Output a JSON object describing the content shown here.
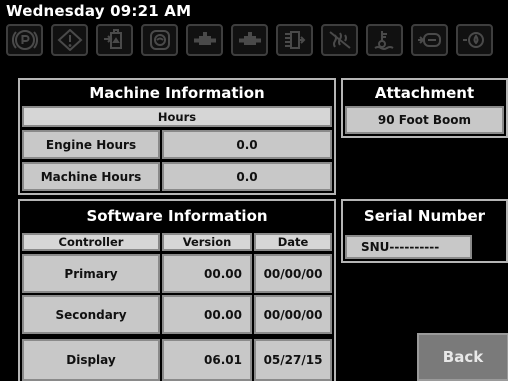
{
  "header": {
    "datetime": "Wednesday 09:21 AM",
    "icons": [
      "parking-brake-icon",
      "warning-icon",
      "fuel-filter-icon",
      "air-filter-icon",
      "hydraulic-icon",
      "hydraulic-oil-icon",
      "transmission-icon",
      "glow-plug-icon",
      "coolant-temp-icon",
      "engine-icon",
      "oil-pressure-icon"
    ]
  },
  "machine_info": {
    "title": "Machine Information",
    "hours_header": "Hours",
    "rows": [
      {
        "label": "Engine Hours",
        "value": "0.0"
      },
      {
        "label": "Machine Hours",
        "value": "0.0"
      }
    ]
  },
  "attachment": {
    "title": "Attachment",
    "value": "90 Foot Boom"
  },
  "software_info": {
    "title": "Software Information",
    "headers": {
      "controller": "Controller",
      "version": "Version",
      "date": "Date"
    },
    "rows": [
      {
        "controller": "Primary",
        "version": "00.00",
        "date": "00/00/00"
      },
      {
        "controller": "Secondary",
        "version": "00.00",
        "date": "00/00/00"
      },
      {
        "controller": "Display",
        "version": "06.01",
        "date": "05/27/15"
      }
    ]
  },
  "serial": {
    "title": "Serial Number",
    "value": "SNU----------"
  },
  "back_button": {
    "label": "Back"
  }
}
